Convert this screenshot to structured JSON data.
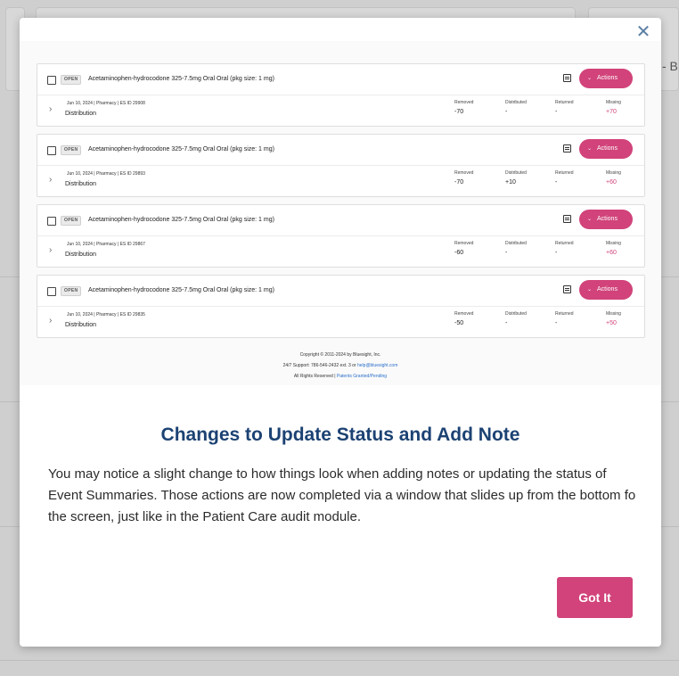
{
  "background": {
    "text": "- B"
  },
  "dialog": {
    "close_icon": "close-icon",
    "heading": "Changes to Update Status and Add Note",
    "body": "You may notice a slight change to how things look when adding notes or updating the status of Event Summaries. Those actions are now completed via a window that slides up from the bottom fo the screen, just like in the Patient Care audit module.",
    "button_label": "Got It",
    "accent_color": "#d1437a",
    "heading_color": "#1c4273"
  },
  "preview": {
    "stat_labels": {
      "removed": "Removed",
      "distributed": "Distributed",
      "returned": "Returned",
      "missing": "Missing"
    },
    "cards": [
      {
        "status": "OPEN",
        "title": "Acetaminophen-hydrocodone 325-7.5mg Oral Oral (pkg size: 1 mg)",
        "meta": "Jun 10, 2024  |   Pharmacy  |   ES ID 29908",
        "type": "Distribution",
        "actions": "Actions",
        "removed": "-70",
        "distributed": "-",
        "returned": "-",
        "missing": "+70"
      },
      {
        "status": "OPEN",
        "title": "Acetaminophen-hydrocodone 325-7.5mg Oral Oral (pkg size: 1 mg)",
        "meta": "Jun 10, 2024  |   Pharmacy  |   ES ID 29893",
        "type": "Distribution",
        "actions": "Actions",
        "removed": "-70",
        "distributed": "+10",
        "returned": "-",
        "missing": "+60"
      },
      {
        "status": "OPEN",
        "title": "Acetaminophen-hydrocodone 325-7.5mg Oral Oral (pkg size: 1 mg)",
        "meta": "Jun 10, 2024  |   Pharmacy  |   ES ID 29867",
        "type": "Distribution",
        "actions": "Actions",
        "removed": "-60",
        "distributed": "-",
        "returned": "-",
        "missing": "+60"
      },
      {
        "status": "OPEN",
        "title": "Acetaminophen-hydrocodone 325-7.5mg Oral Oral (pkg size: 1 mg)",
        "meta": "Jun 10, 2024  |   Pharmacy  |   ES ID 29835",
        "type": "Distribution",
        "actions": "Actions",
        "removed": "-50",
        "distributed": "-",
        "returned": "-",
        "missing": "+50"
      }
    ],
    "footer": {
      "copyright": "Copyright © 2011-2024 by Bluesight, Inc.",
      "support_prefix": "24/7 Support: 786-546-2432 ext. 3 or ",
      "support_email": "help@bluesight.com",
      "rights_prefix": "All Rights Reserved | ",
      "patents_link": "Patents Granted/Pending"
    }
  }
}
